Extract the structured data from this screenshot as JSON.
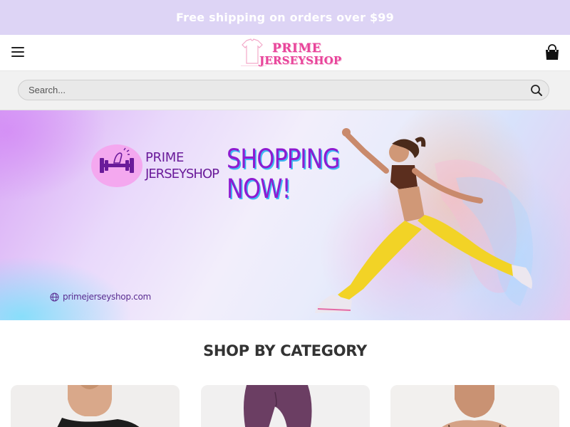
{
  "topbar": {
    "promo_text": "Free shipping on orders over $99"
  },
  "header": {
    "menu_icon": "hamburger-menu-icon",
    "logo": {
      "line1": "PRIME",
      "line2": "JERSEYSHOP"
    },
    "cart_icon": "shopping-bag-icon"
  },
  "search": {
    "placeholder": "Search...",
    "icon": "search-icon"
  },
  "hero": {
    "brand_line1": "PRIME",
    "brand_line2": "JERSEYSHOP",
    "headline_line1": "SHOPPING",
    "headline_line2": "NOW!",
    "website": "primejerseyshop.com",
    "colors": {
      "headline": "#8e1bd1",
      "brand": "#6a1b9a",
      "badge": "#f4a8ef"
    }
  },
  "categories": {
    "title": "SHOP BY CATEGORY"
  },
  "colors": {
    "topbar_bg": "#ddd4f5",
    "accent": "#e8449a"
  }
}
